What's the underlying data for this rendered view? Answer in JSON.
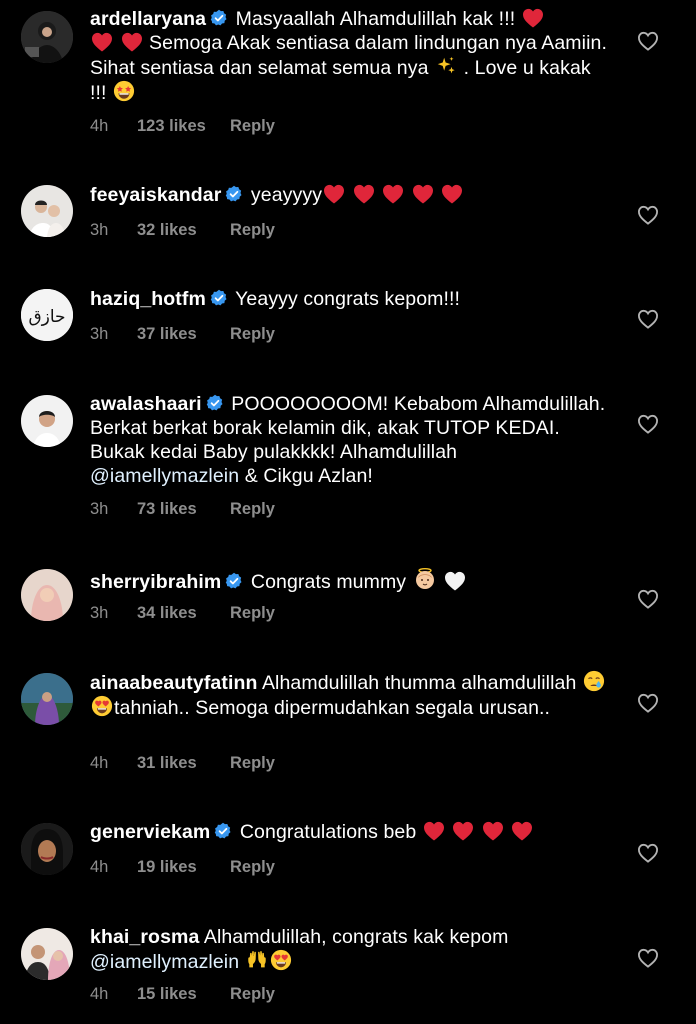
{
  "colors": {
    "background": "#000000",
    "text": "#ffffff",
    "meta": "#8e8e8e",
    "verified": "#3897f0",
    "heart_emoji": "#e0263a"
  },
  "reply_label": "Reply",
  "like_icon": "heart-outline-icon",
  "comments": [
    {
      "username": "ardellaryana",
      "verified": true,
      "text_parts": [
        "Masyaallah Alhamdulillah kak !!! ",
        "",
        "",
        " Semoga Akak sentiasa dalam lindungan nya Aamiin. Sihat sentiasa dan selamat semua nya ",
        " . Love u  kakak !!! ",
        ""
      ],
      "emojis": [
        "red-heart-emoji",
        "red-heart-emoji",
        "red-heart-emoji",
        "sparkles-emoji",
        "star-struck-emoji"
      ],
      "time": "4h",
      "likes": "123 likes"
    },
    {
      "username": "feeyaiskandar",
      "verified": true,
      "text": "yeayyyy",
      "emojis": [
        "red-heart-emoji",
        "red-heart-emoji",
        "red-heart-emoji",
        "red-heart-emoji",
        "red-heart-emoji"
      ],
      "time": "3h",
      "likes": "32 likes"
    },
    {
      "username": "haziq_hotfm",
      "verified": true,
      "text": "Yeayyy congrats kepom!!!",
      "avatar_text": "حازق",
      "time": "3h",
      "likes": "37 likes"
    },
    {
      "username": "awalashaari",
      "verified": true,
      "text": "POOOOOOOOM! Kebabom Alhamdulillah. Berkat berkat borak kelamin dik, akak TUTOP KEDAI. Bukak kedai Baby pulakkkk! Alhamdulillah ",
      "mention": "@iamellymazlein",
      "text_after": " & Cikgu Azlan!",
      "time": "3h",
      "likes": "73 likes"
    },
    {
      "username": "sherryibrahim",
      "verified": true,
      "text": "Congrats mummy ",
      "emojis": [
        "baby-angel-emoji",
        "white-heart-emoji"
      ],
      "time": "3h",
      "likes": "34 likes"
    },
    {
      "username": "ainaabeautyfatinn",
      "verified": false,
      "text": "Alhamdulillah thumma alhamdulillah ",
      "text_after": "tahniah.. Semoga dipermudahkan segala urusan..",
      "emojis": [
        "crying-face-emoji",
        "heart-eyes-emoji"
      ],
      "time": "4h",
      "likes": "31 likes"
    },
    {
      "username": "generviekam",
      "verified": true,
      "text": "Congratulations beb ",
      "emojis": [
        "red-heart-emoji",
        "red-heart-emoji",
        "red-heart-emoji",
        "red-heart-emoji"
      ],
      "time": "4h",
      "likes": "19 likes"
    },
    {
      "username": "khai_rosma",
      "verified": false,
      "text": "Alhamdulillah, congrats kak kepom ",
      "mention": "@iamellymazlein",
      "emojis": [
        "raising-hands-emoji",
        "heart-eyes-emoji"
      ],
      "time": "4h",
      "likes": "15 likes"
    }
  ]
}
